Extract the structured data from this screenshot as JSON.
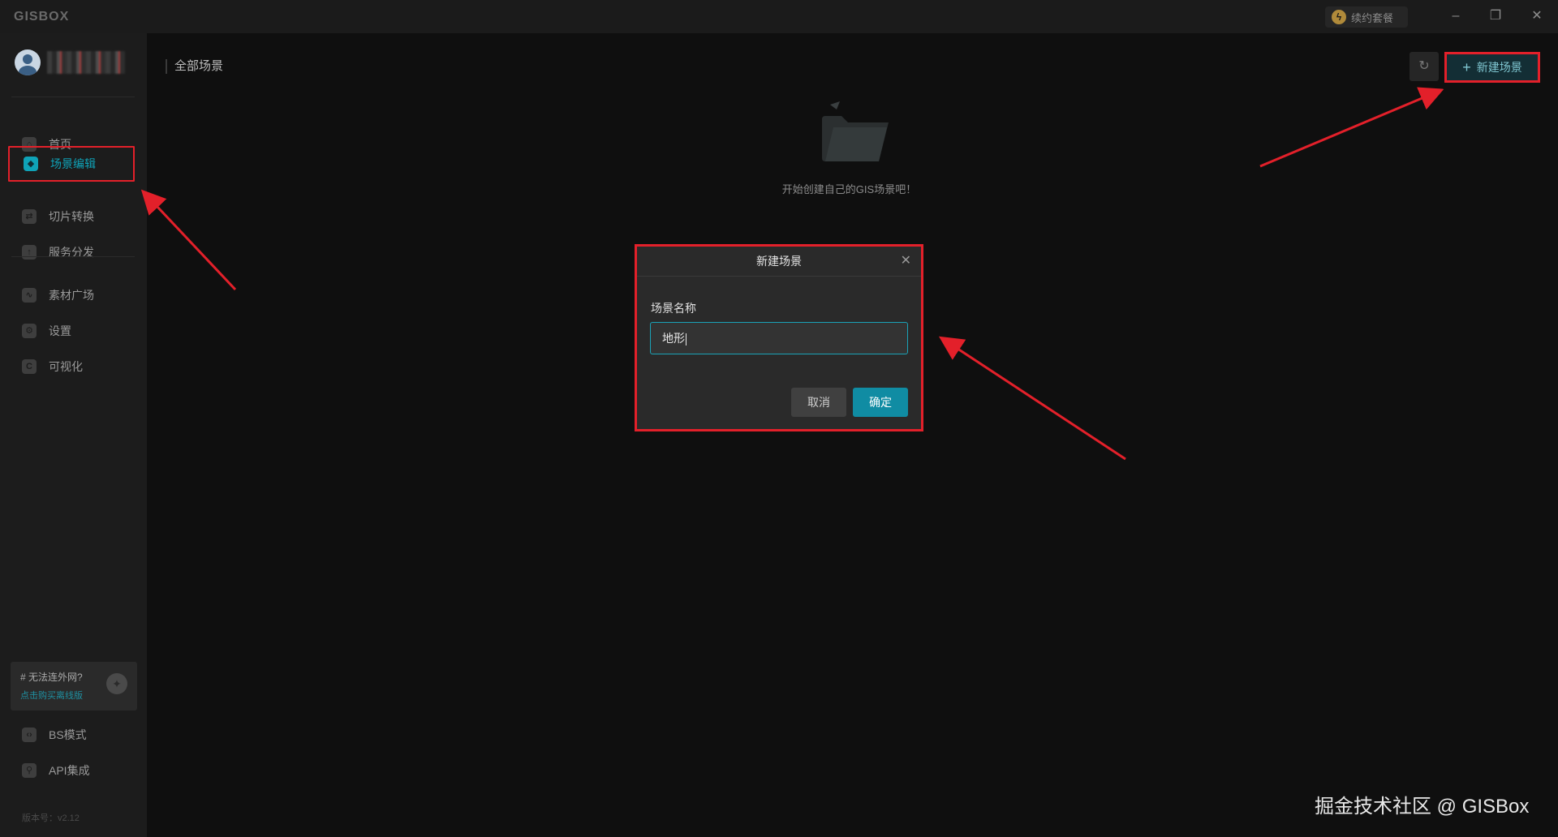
{
  "titlebar": {
    "logo": "GISBOX",
    "subscription_label": "续约套餐",
    "minimize": "–",
    "restore": "❐",
    "close": "✕"
  },
  "sidebar": {
    "items_top": [
      {
        "label": "首页",
        "icon": "home-icon",
        "glyph": "⌂"
      },
      {
        "label": "场景编辑",
        "icon": "cube-icon",
        "glyph": "◆",
        "active": true
      },
      {
        "label": "切片转换",
        "icon": "convert-icon",
        "glyph": "⇄"
      },
      {
        "label": "服务分发",
        "icon": "upload-icon",
        "glyph": "↑"
      }
    ],
    "items_mid": [
      {
        "label": "素材广场",
        "icon": "chart-icon",
        "glyph": "∿"
      },
      {
        "label": "设置",
        "icon": "gear-icon",
        "glyph": "⚙"
      },
      {
        "label": "可视化",
        "icon": "visual-icon",
        "glyph": "C"
      }
    ],
    "promo": {
      "title": "# 无法连外网?",
      "link": "点击购买离线版"
    },
    "items_bottom": [
      {
        "label": "BS模式",
        "icon": "code-icon",
        "glyph": "‹›"
      },
      {
        "label": "API集成",
        "icon": "api-icon",
        "glyph": "⚲"
      }
    ],
    "version": "版本号：v2.12"
  },
  "main": {
    "title": "全部场景",
    "new_scene_button": "新建场景",
    "refresh_glyph": "↻",
    "empty_text": "开始创建自己的GIS场景吧！"
  },
  "dialog": {
    "title": "新建场景",
    "close_glyph": "✕",
    "field_label": "场景名称",
    "field_value": "地形",
    "cancel": "取消",
    "confirm": "确定"
  },
  "watermark": "掘金技术社区 @ GISBox",
  "colors": {
    "accent": "#0fa3b8",
    "highlight": "#e3202a",
    "background": "#0f0f0f"
  }
}
